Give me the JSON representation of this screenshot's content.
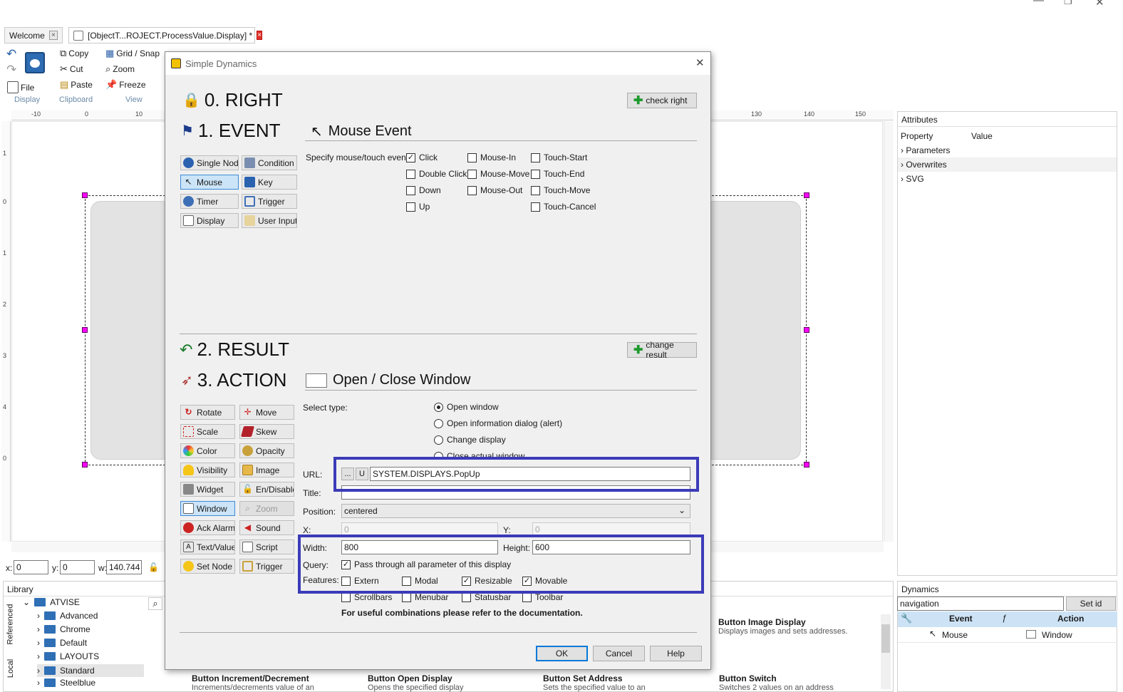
{
  "window": {
    "minimize": "—",
    "restore": "❐",
    "close": "✕"
  },
  "tabs": [
    {
      "label": "Welcome"
    },
    {
      "label": "[ObjectT...ROJECT.ProcessValue.Display] *"
    }
  ],
  "ribbon": {
    "file": "File",
    "copy": "Copy",
    "cut": "Cut",
    "paste": "Paste",
    "grid_snap": "Grid / Snap",
    "zoom": "Zoom",
    "freeze": "Freeze",
    "groups": [
      "Display",
      "Clipboard",
      "View"
    ]
  },
  "ruler": {
    "top_ticks": [
      "-10",
      "0",
      "10",
      "130",
      "140",
      "150"
    ],
    "left_ticks": [
      "1",
      "0",
      "1",
      "2",
      "3",
      "4",
      "0"
    ]
  },
  "coords": {
    "x_label": "x:",
    "x_value": "0",
    "y_label": "y:",
    "y_value": "0",
    "w_label": "w:",
    "w_value": "140.744"
  },
  "attributes": {
    "title": "Attributes",
    "col_property": "Property",
    "col_value": "Value",
    "items": [
      "Parameters",
      "Overwrites",
      "SVG"
    ]
  },
  "library": {
    "title": "Library",
    "side_tabs": [
      "Referenced",
      "Local"
    ],
    "root": "ATVISE",
    "folders": [
      "Advanced",
      "Chrome",
      "Default",
      "LAYOUTS",
      "Standard",
      "Steelblue"
    ],
    "cards": [
      {
        "title": "Button Image Display",
        "desc": "Displays images and sets addresses."
      },
      {
        "title": "Button Increment/Decrement",
        "desc": "Increments/decrements value of an"
      },
      {
        "title": "Button Open Display",
        "desc": "Opens the specified display"
      },
      {
        "title": "Button Set Address",
        "desc": "Sets the specified value to an"
      },
      {
        "title": "Button Switch",
        "desc": "Switches 2 values on an address"
      }
    ]
  },
  "dynamics": {
    "title": "Dynamics",
    "search_value": "navigation",
    "set_id": "Set id",
    "col_event": "Event",
    "col_action": "Action",
    "row_event": "Mouse",
    "row_action": "Window"
  },
  "dialog": {
    "title": "Simple Dynamics",
    "close": "✕",
    "right": {
      "heading": "0. RIGHT",
      "button": "check right"
    },
    "event": {
      "heading": "1. EVENT",
      "subheading": "Mouse Event",
      "buttons": [
        "Single Node",
        "Condition",
        "Mouse",
        "Key",
        "Timer",
        "Trigger",
        "Display",
        "User Input"
      ],
      "specify_label": "Specify mouse/touch event:",
      "checks": [
        {
          "label": "Click",
          "checked": true
        },
        {
          "label": "Double Click",
          "checked": false
        },
        {
          "label": "Down",
          "checked": false
        },
        {
          "label": "Up",
          "checked": false
        },
        {
          "label": "Mouse-In",
          "checked": false
        },
        {
          "label": "Mouse-Move",
          "checked": false
        },
        {
          "label": "Mouse-Out",
          "checked": false
        },
        {
          "label": "Touch-Start",
          "checked": false
        },
        {
          "label": "Touch-End",
          "checked": false
        },
        {
          "label": "Touch-Move",
          "checked": false
        },
        {
          "label": "Touch-Cancel",
          "checked": false
        }
      ]
    },
    "result": {
      "heading": "2. RESULT",
      "button": "change result"
    },
    "action": {
      "heading": "3. ACTION",
      "subheading": "Open / Close Window",
      "buttons": [
        "Rotate",
        "Move",
        "Scale",
        "Skew",
        "Color",
        "Opacity",
        "Visibility",
        "Image",
        "Widget",
        "En/Disable",
        "Window",
        "Zoom",
        "Ack Alarm",
        "Sound",
        "Text/Value",
        "Script",
        "Set Node",
        "Trigger"
      ],
      "select_type_label": "Select type:",
      "types": [
        {
          "label": "Open window",
          "selected": true
        },
        {
          "label": "Open information dialog (alert)",
          "selected": false
        },
        {
          "label": "Change display",
          "selected": false
        },
        {
          "label": "Close actual window",
          "selected": false
        }
      ],
      "url_label": "URL:",
      "url_browse": "...",
      "url_u": "U",
      "url_value": "SYSTEM.DISPLAYS.PopUp",
      "title_label": "Title:",
      "title_value": "",
      "position_label": "Position:",
      "position_value": "centered",
      "x_label": "X:",
      "x_value": "0",
      "y_label": "Y:",
      "y_value": "0",
      "width_label": "Width:",
      "width_value": "800",
      "height_label": "Height:",
      "height_value": "600",
      "query_label": "Query:",
      "query_check": "Pass through all parameter of this display",
      "features_label": "Features:",
      "features": [
        {
          "label": "Extern",
          "checked": false
        },
        {
          "label": "Modal",
          "checked": false
        },
        {
          "label": "Resizable",
          "checked": true
        },
        {
          "label": "Movable",
          "checked": true
        },
        {
          "label": "Scrollbars",
          "checked": false
        },
        {
          "label": "Menubar",
          "checked": false
        },
        {
          "label": "Statusbar",
          "checked": false
        },
        {
          "label": "Toolbar",
          "checked": false
        }
      ],
      "note": "For useful combinations please refer to the documentation."
    },
    "ok": "OK",
    "cancel": "Cancel",
    "help": "Help"
  },
  "colors": {
    "highlight": "#3b3bb8",
    "handle": "#ff00ff",
    "accent": "#0078d7"
  }
}
